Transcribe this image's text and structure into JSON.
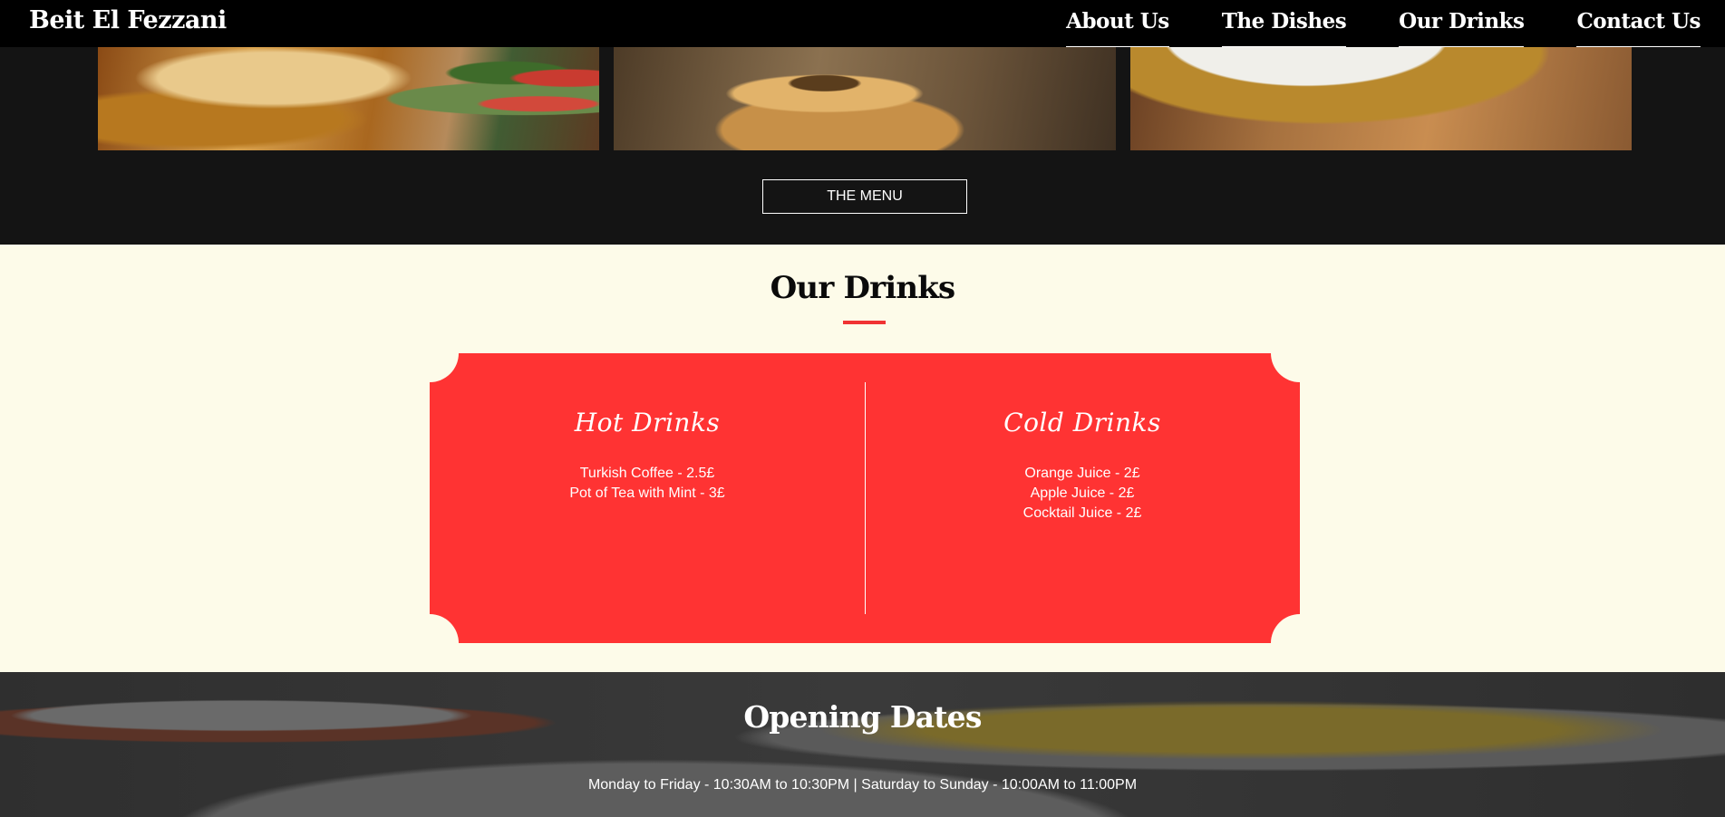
{
  "nav": {
    "brand": "Beit El Fezzani",
    "links": [
      "About Us",
      "The Dishes",
      "Our Drinks",
      "Contact Us"
    ]
  },
  "gallery": {
    "menu_button": "THE MENU"
  },
  "drinks": {
    "title": "Our Drinks",
    "hot": {
      "title": "Hot Drinks",
      "items": [
        "Turkish Coffee - 2.5£",
        "Pot of Tea with Mint - 3£"
      ]
    },
    "cold": {
      "title": "Cold Drinks",
      "items": [
        "Orange Juice - 2£",
        "Apple Juice - 2£",
        "Cocktail Juice - 2£"
      ]
    },
    "accent_color": "#ff3333"
  },
  "opening": {
    "title": "Opening Dates",
    "hours": "Monday to Friday - 10:30AM to 10:30PM | Saturday to Sunday - 10:00AM to 11:00PM"
  }
}
